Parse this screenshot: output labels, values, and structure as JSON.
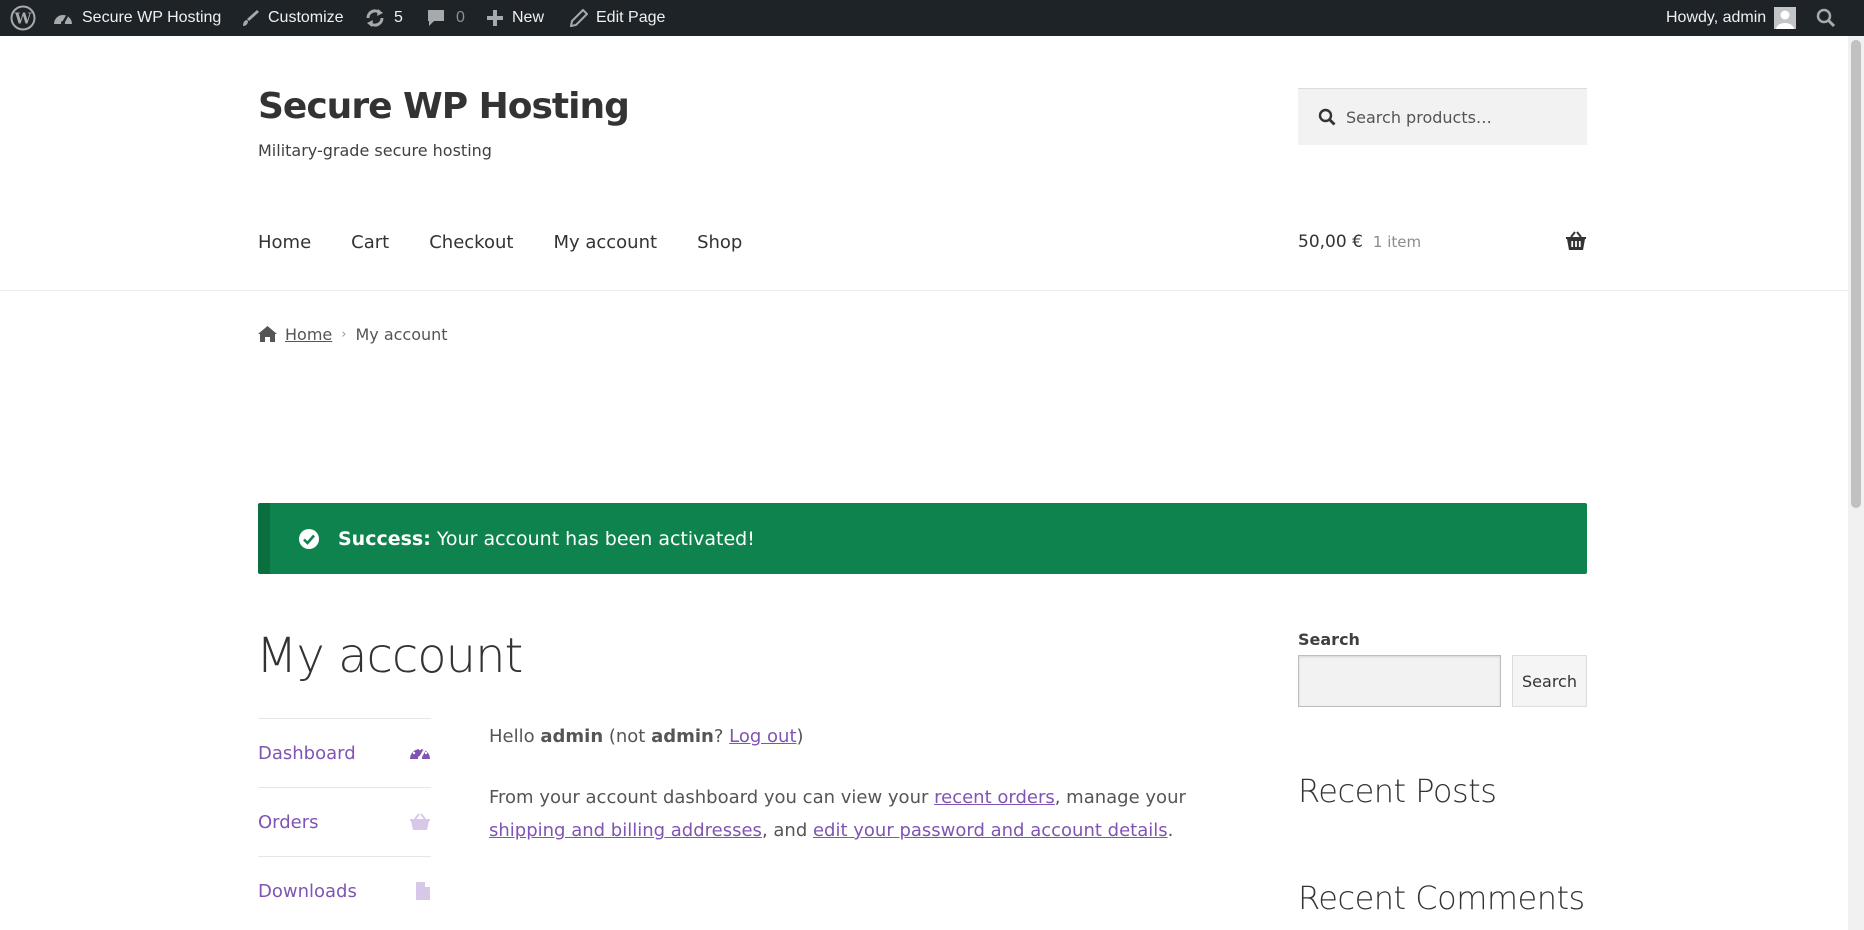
{
  "admin_bar": {
    "site_name": "Secure WP Hosting",
    "customize": "Customize",
    "updates_count": "5",
    "comments_count": "0",
    "new": "New",
    "edit_page": "Edit Page",
    "howdy": "Howdy, admin"
  },
  "header": {
    "site_title": "Secure WP Hosting",
    "tagline": "Military-grade secure hosting",
    "search_placeholder": "Search products…",
    "nav": [
      "Home",
      "Cart",
      "Checkout",
      "My account",
      "Shop"
    ],
    "cart_amount": "50,00 €",
    "cart_count": "1 item"
  },
  "breadcrumb": {
    "home": "Home",
    "current": "My account"
  },
  "notice": {
    "label": "Success:",
    "message": "Your account has been activated!"
  },
  "main": {
    "title": "My account",
    "account_nav": [
      "Dashboard",
      "Orders",
      "Downloads"
    ],
    "greeting": {
      "hello": "Hello ",
      "user": "admin",
      "not": " (not ",
      "user2": "admin",
      "question": "? ",
      "logout": "Log out",
      "close": ")"
    },
    "dashboard_text": {
      "part1": "From your account dashboard you can view your ",
      "recent_orders": "recent orders",
      "part2": ", manage your ",
      "addresses": "shipping and billing addresses",
      "part3": ", and ",
      "account_details": "edit your password and account details",
      "part4": "."
    }
  },
  "sidebar": {
    "search_label": "Search",
    "search_button": "Search",
    "recent_posts": "Recent Posts",
    "recent_comments": "Recent Comments"
  },
  "colors": {
    "admin_bar": "#1d2327",
    "notice_success": "#0f834d",
    "link_purple": "#7f54b3"
  },
  "icons": {
    "wordpress": "wordpress-logo-icon",
    "dashboard": "dashboard-gauge-icon",
    "orders": "shopping-basket-icon",
    "downloads": "file-icon"
  }
}
